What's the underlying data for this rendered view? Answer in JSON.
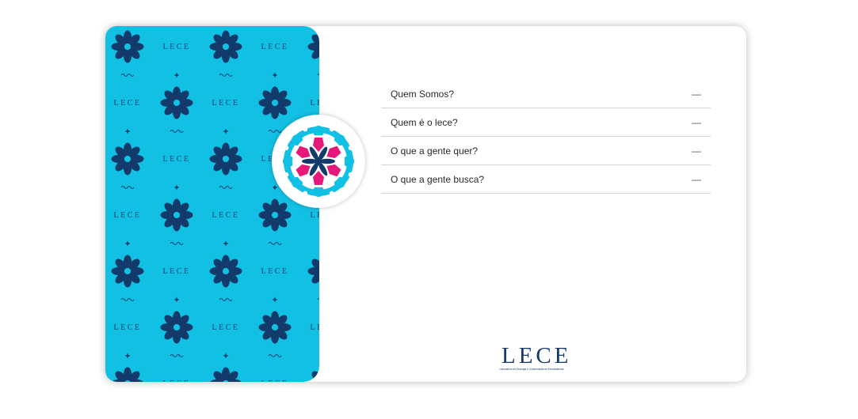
{
  "pattern": {
    "word": "LECE",
    "color_background": "#12c0e4",
    "color_motif": "#123b6b",
    "icons": [
      "flower-icon",
      "sparkle-icon",
      "wave-icon"
    ]
  },
  "logo_emblem": {
    "icon": "flower-emblem-icon",
    "colors": {
      "ring": "#12c0e4",
      "petals": "#e6197a",
      "center": "#123b6b"
    }
  },
  "faq": {
    "items": [
      {
        "question": "Quem Somos?",
        "toggle": "—"
      },
      {
        "question": "Quem é o lece?",
        "toggle": "—"
      },
      {
        "question": "O que a gente quer?",
        "toggle": "—"
      },
      {
        "question": "O que a gente busca?",
        "toggle": "—"
      }
    ]
  },
  "brand": {
    "name": "LECE",
    "subtitle": "Laboratório de Ecologia e Conservação de Ecossistemas",
    "color": "#123b6b"
  }
}
